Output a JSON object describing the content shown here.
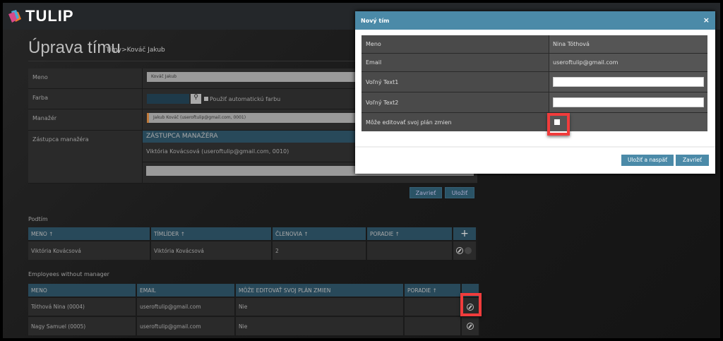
{
  "app": {
    "logo": "TULIP"
  },
  "page": {
    "title": "Úprava tímu",
    "breadcrumb": "Tímy>Kováč Jakub"
  },
  "form": {
    "name_label": "Meno",
    "name_value": "Kováč Jakub",
    "color_label": "Farba",
    "auto_color_label": "Použiť automatickú farbu",
    "manager_label": "Manažér",
    "manager_value": "Jakub Kováč (useroftulip@gmail.com, 0001)",
    "deputy_label": "Zástupca manažéra",
    "deputy_header": "ZÁSTUPCA MANAŽÉRA",
    "deputy_value": "Viktória Kovácsová (useroftulip@gmail.com, 0010)",
    "close_label": "Zavrieť",
    "save_label": "Uložiť"
  },
  "subteams": {
    "title": "Podtím",
    "columns": [
      "MENO ↑",
      "TÍMLÍDER ↑",
      "ČLENOVIA ↑",
      "PORADIE ↑"
    ],
    "add": "+",
    "rows": [
      {
        "name": "Viktória Kovácsová",
        "leader": "Viktória Kovácsová",
        "members": "2",
        "order": ""
      }
    ]
  },
  "employees": {
    "title": "Employees without manager",
    "columns": [
      "MENO",
      "EMAIL",
      "MÔŽE EDITOVAŤ SVOJ PLÁN ZMIEN",
      "PORADIE ↑"
    ],
    "rows": [
      {
        "name": "Tóthová Nina (0004)",
        "email": "useroftulip@gmail.com",
        "can_edit": "Nie",
        "order": ""
      },
      {
        "name": "Nagy Samuel (0005)",
        "email": "useroftulip@gmail.com",
        "can_edit": "Nie",
        "order": ""
      }
    ]
  },
  "modal": {
    "title": "Nový tím",
    "close": "×",
    "name_label": "Meno",
    "name_value": "Nina Tóthová",
    "email_label": "Email",
    "email_value": "useroftulip@gmail.com",
    "text1_label": "Voľný Text1",
    "text1_value": "",
    "text2_label": "Voľný Text2",
    "text2_value": "",
    "can_edit_label": "Môže editovať svoj plán zmien",
    "can_edit_checked": false,
    "save_back_label": "Uložiť a naspäť",
    "close_label": "Zavrieť"
  }
}
